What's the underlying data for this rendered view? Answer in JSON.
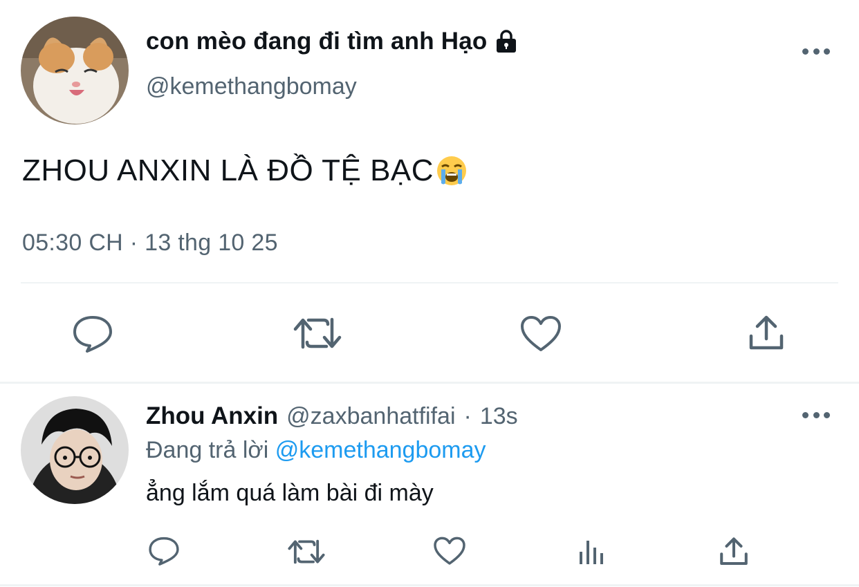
{
  "main_tweet": {
    "display_name": "con mèo đang đi tìm anh Hạo",
    "protected_icon": "lock-icon",
    "handle": "@kemethangbomay",
    "text": "ZHOU ANXIN LÀ ĐỒ TỆ BẠC",
    "emoji": "loudly-crying-face-icon",
    "timestamp": "05:30 CH · 13 thg 10 25",
    "actions": [
      "reply-icon",
      "retweet-icon",
      "like-icon",
      "share-icon"
    ]
  },
  "reply_tweet": {
    "display_name": "Zhou Anxin",
    "handle": "@zaxbanhatfifai",
    "separator": "·",
    "time": "13s",
    "replying_prefix": "Đang trả lời",
    "replying_to": "@kemethangbomay",
    "text": "ẳng lắm quá làm bài đi mày",
    "actions": [
      "reply-icon",
      "retweet-icon",
      "like-icon",
      "analytics-icon",
      "share-icon"
    ]
  },
  "colors": {
    "text_primary": "#0f1419",
    "text_secondary": "#536471",
    "link": "#1d9bf0",
    "divider": "#eff3f4"
  }
}
